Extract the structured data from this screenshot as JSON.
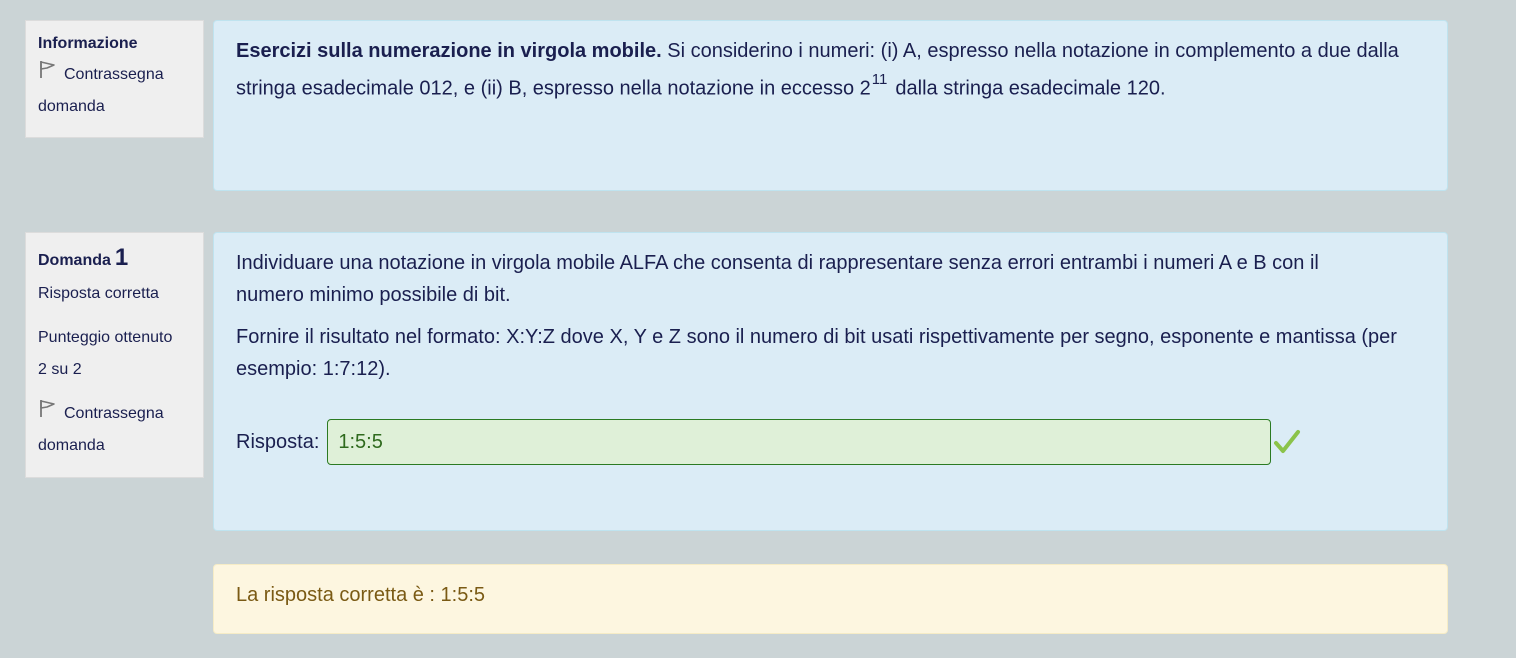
{
  "info_block": {
    "title": "Informazione",
    "flag_label": "Contrassegna domanda"
  },
  "info_content": {
    "bold_text": "Esercizi sulla numerazione in virgola mobile.",
    "text_before_sup": " Si considerino i numeri: (i) A, espresso nella notazione in complemento a due dalla stringa esadecimale 012, e (ii) B, espresso nella notazione in eccesso 2",
    "superscript": "11",
    "text_after_sup": "dalla stringa esadecimale 120."
  },
  "question_block": {
    "title": "Domanda",
    "number": "1",
    "status": "Risposta corretta",
    "score_label": "Punteggio ottenuto",
    "score_value": "2 su 2",
    "flag_label": "Contrassegna domanda"
  },
  "question_content": {
    "paragraph1": "Individuare una notazione in virgola mobile ALFA che consenta di rappresentare senza errori entrambi i numeri A e B con il numero minimo possibile di bit.",
    "paragraph2": "Fornire il risultato nel formato: X:Y:Z dove X, Y e Z sono il numero di bit usati rispettivamente per segno, esponente e mantissa (per esempio: 1:7:12).",
    "answer_label": "Risposta:",
    "answer_value": "1:5:5"
  },
  "feedback": {
    "text": "La risposta corretta è : 1:5:5"
  },
  "icons": {
    "flag": "flag-icon",
    "check": "check-icon"
  },
  "colors": {
    "page_bg": "#cbd4d6",
    "content_bg": "#dbecf6",
    "info_bg": "#efefef",
    "text": "#1a1f4f",
    "answer_bg": "#dff0d8",
    "answer_border": "#2b7a22",
    "check": "#8bc34a",
    "feedback_bg": "#fdf6e0",
    "feedback_text": "#7a5a14"
  }
}
